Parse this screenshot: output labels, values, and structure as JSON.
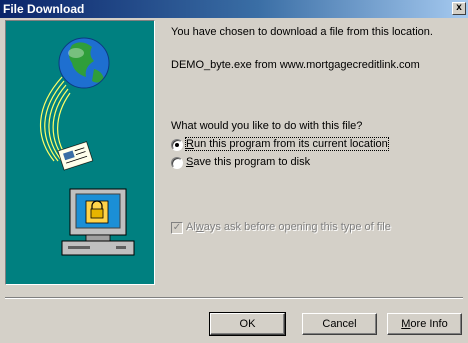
{
  "window": {
    "title": "File Download",
    "close_glyph": "x"
  },
  "main": {
    "intro": "You have chosen to download a file from this location.",
    "file_source": "DEMO_byte.exe from www.mortgagecreditlink.com",
    "question": "What would you like to do with this file?",
    "options": [
      {
        "label_prefix": "",
        "label_accel": "R",
        "label_rest": "un this program from its current location",
        "selected": true
      },
      {
        "label_prefix": "",
        "label_accel": "S",
        "label_rest": "ave this program to disk",
        "selected": false
      }
    ],
    "always_ask": {
      "label_prefix": "Al",
      "label_accel": "w",
      "label_rest": "ays ask before opening this type of file",
      "checked": true,
      "enabled": false
    }
  },
  "buttons": {
    "ok": "OK",
    "cancel": "Cancel",
    "more_info_accel": "M",
    "more_info_rest": "ore Info"
  },
  "colors": {
    "title_bar": "#0a246a",
    "illustration_bg": "#008080",
    "dialog_bg": "#d4d0c8"
  }
}
